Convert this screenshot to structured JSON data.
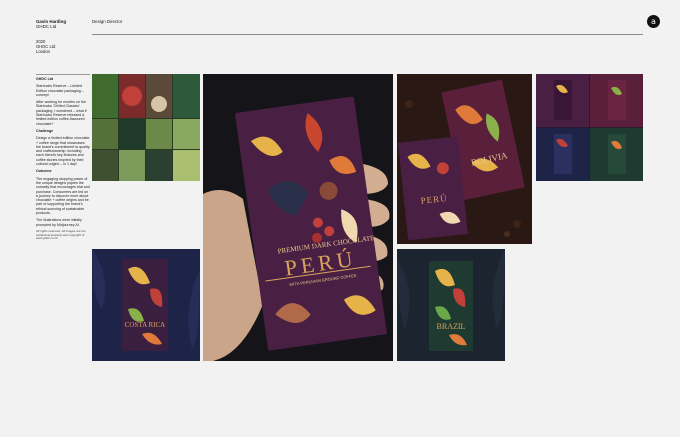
{
  "header": {
    "author_name": "Gavin Harding",
    "author_company": "GHDC Ltd",
    "role": "Design Director",
    "logo_glyph": "a",
    "year": "2020",
    "company": "GHDC Ltd",
    "city": "London"
  },
  "sidebar": {
    "client": "GHDC Ltd",
    "project": "Starbucks Reserve – Limited Edition chocolate packaging – concept",
    "intro": "After working for months on the Starbucks 'Chilled Classics' packaging, I wondered – what if Starbucks Reserve released a limited edition coffee-flavoured chocolate?",
    "challenge_heading": "Challenge",
    "challenge_text": "Design a limited edition chocolate + coffee range that showcases the brand's commitment to quality and craftsmanship, including each blend's key features and coffee stories inspired by their cultural origins – in 1 day!",
    "outcome_heading": "Outcome",
    "outcome_text": "The engaging stopping power of the unique designs piques the curiosity that encourages trial and purchase. Consumers are led on a journey to discover more about chocolate + coffee origins and be part of supporting the brand's ethical sourcing of sustainable products.",
    "illustrations_note": "The illustrations were initially prompted by Midjourney AI.",
    "rights_note": "All rights reserved. All images are the intellectual property and copyright of www.ghdc.co.uk"
  },
  "packaging": {
    "main_label": "PERÚ",
    "main_tagline": "PREMIUM DARK CHOCOLATE",
    "main_subline": "WITH PERUVIAN GROUND COFFEE",
    "bolivia_label": "BOLIVIA",
    "costa_rica_label": "COSTA RICA",
    "brazil_label": "BRAZIL"
  },
  "colors": {
    "page_bg": "#f2f2f2",
    "pack_purple": "#4a1f44",
    "pack_dark": "#1b1a22",
    "accent_gold": "#d8a45c",
    "pack_navy": "#1e2448"
  }
}
